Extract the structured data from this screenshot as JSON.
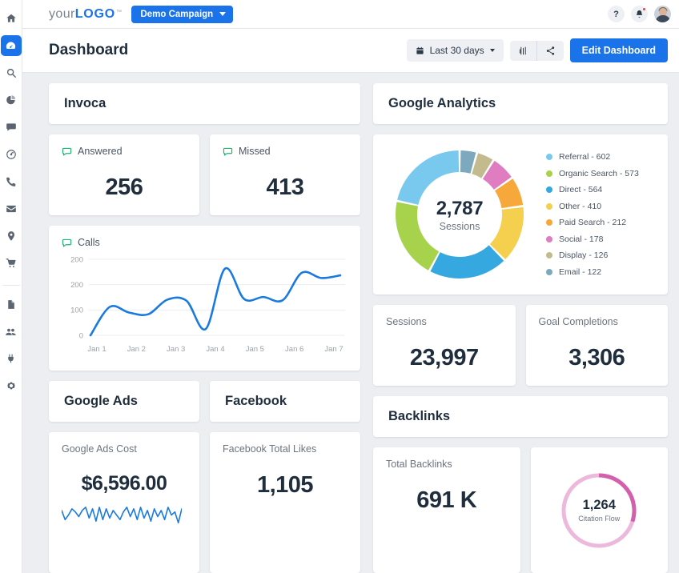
{
  "colors": {
    "brand_blue": "#1a73e8",
    "green": "#1fb573",
    "line_blue": "#1a7ae0",
    "pink": "#d45fad",
    "pink_light": "#ecb9dd",
    "text_dark": "#1f2d3d"
  },
  "sidebar": {
    "items": [
      {
        "name": "home-icon",
        "label": "Home",
        "active": false
      },
      {
        "name": "dashboard-icon",
        "label": "Dashboard",
        "active": true
      },
      {
        "name": "search-icon",
        "label": "Search",
        "active": false
      },
      {
        "name": "pie-chart-icon",
        "label": "Reports",
        "active": false
      },
      {
        "name": "comment-icon",
        "label": "Messages",
        "active": false
      },
      {
        "name": "target-icon",
        "label": "Goals",
        "active": false
      },
      {
        "name": "phone-icon",
        "label": "Calls",
        "active": false
      },
      {
        "name": "envelope-icon",
        "label": "Email",
        "active": false
      },
      {
        "name": "map-pin-icon",
        "label": "Locations",
        "active": false
      },
      {
        "name": "shopping-cart-icon",
        "label": "Ecommerce",
        "active": false
      },
      {
        "name": "document-icon",
        "label": "Documents",
        "active": false
      },
      {
        "name": "users-icon",
        "label": "Users",
        "active": false
      },
      {
        "name": "plug-icon",
        "label": "Integrations",
        "active": false
      },
      {
        "name": "gear-icon",
        "label": "Settings",
        "active": false
      }
    ]
  },
  "topbar": {
    "logo_light": "your",
    "logo_bold": "LOGO",
    "logo_tm": "™",
    "campaign_label": "Demo Campaign",
    "help_label": "?",
    "bell_icon": "bell-icon",
    "avatar_label": "User avatar"
  },
  "header": {
    "title": "Dashboard",
    "date_range": "Last 30 days",
    "calendar_icon": "calendar-icon",
    "columns_icon": "columns-icon",
    "share_icon": "share-icon",
    "edit_label": "Edit Dashboard"
  },
  "panels": {
    "invoca": "Invoca",
    "google_analytics": "Google Analytics",
    "google_ads": "Google Ads",
    "facebook": "Facebook",
    "backlinks": "Backlinks"
  },
  "metrics": {
    "answered": {
      "label": "Answered",
      "value": "256",
      "icon": "comment-icon"
    },
    "missed": {
      "label": "Missed",
      "value": "413",
      "icon": "comment-icon"
    },
    "calls": {
      "label": "Calls",
      "icon": "comment-icon"
    },
    "sessions": {
      "label": "Sessions",
      "value": "23,997"
    },
    "goal_completions": {
      "label": "Goal Completions",
      "value": "3,306"
    },
    "google_ads_cost": {
      "label": "Google Ads Cost",
      "value": "$6,596.00"
    },
    "facebook_likes": {
      "label": "Facebook Total Likes",
      "value": "1,105"
    },
    "total_backlinks": {
      "label": "Total Backlinks",
      "value": "691 K"
    },
    "citation_flow": {
      "label": "Citation Flow",
      "value": "1,264"
    }
  },
  "chart_data": [
    {
      "type": "line",
      "title": "Calls",
      "xlabel": "",
      "ylabel": "",
      "x": [
        "Jan 1",
        "Jan 2",
        "Jan 3",
        "Jan 4",
        "Jan 5",
        "Jan 6",
        "Jan 7"
      ],
      "ytick_labels": [
        "200",
        "200",
        "100",
        "0"
      ],
      "ylim": [
        0,
        260
      ],
      "grid": true,
      "legend": "none",
      "series": [
        {
          "name": "Calls",
          "color": "#1a7ae0",
          "values": [
            0,
            97,
            78,
            72,
            122,
            118,
            22,
            228,
            124,
            131,
            120,
            214,
            196,
            205
          ]
        }
      ]
    },
    {
      "type": "pie",
      "title": "Sessions",
      "center_value": "2,787",
      "center_label": "Sessions",
      "legend": "right",
      "total": 2787,
      "categories": [
        "Referral",
        "Organic Search",
        "Direct",
        "Other",
        "Paid Search",
        "Social",
        "Display",
        "Email"
      ],
      "values": [
        602,
        573,
        564,
        410,
        212,
        178,
        126,
        122
      ],
      "colors": [
        "#79c9ef",
        "#a7d24b",
        "#36a8e0",
        "#f5cf4e",
        "#f7a83a",
        "#e07cc0",
        "#c3bb8e",
        "#7da9be"
      ],
      "labels": [
        "Referral - 602",
        "Organic Search - 573",
        "Direct - 564",
        "Other - 410",
        "Paid Search - 212",
        "Social - 178",
        "Display - 126",
        "Email - 122"
      ]
    },
    {
      "type": "line",
      "title": "Google Ads Cost sparkline",
      "x": [],
      "series": [
        {
          "name": "cost",
          "color": "#1a7ae0",
          "values": [
            10,
            4,
            7,
            11,
            9,
            6,
            10,
            12,
            5,
            11,
            3,
            12,
            4,
            11,
            5,
            10,
            7,
            4,
            9,
            12,
            6,
            11,
            4,
            12,
            5,
            10,
            3,
            11,
            6,
            10,
            4,
            12,
            7,
            9,
            2,
            11
          ]
        }
      ]
    },
    {
      "type": "pie",
      "title": "Citation Flow",
      "center_value": "1,264",
      "center_label": "Citation Flow",
      "categories": [
        "Citation Flow",
        "Remainder"
      ],
      "values": [
        30,
        70
      ],
      "colors": [
        "#d45fad",
        "#ecb9dd"
      ]
    }
  ]
}
